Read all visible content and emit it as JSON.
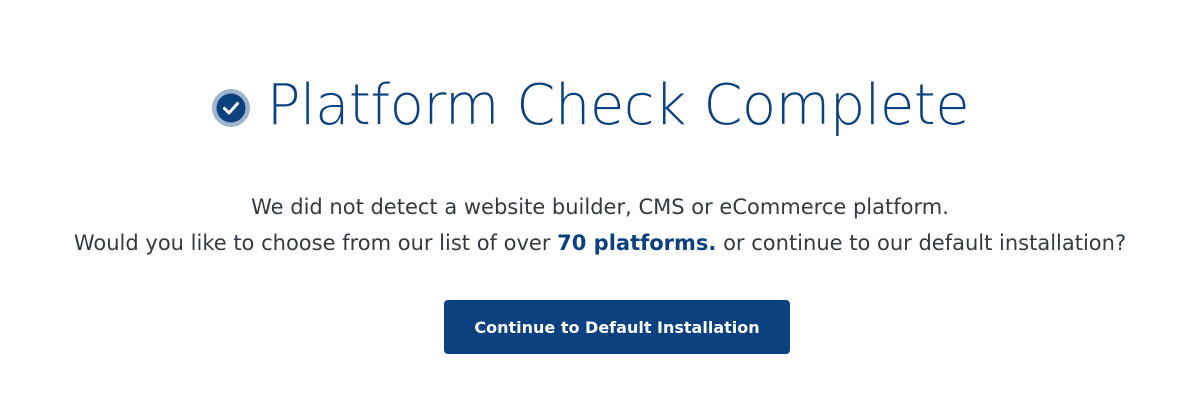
{
  "header": {
    "title": "Platform Check Complete",
    "badge_icon": "check-circle-icon"
  },
  "message": {
    "line1": "We did not detect a website builder, CMS or eCommerce platform.",
    "line2_before": "Would you like to choose from our list of over ",
    "line2_link": "70 platforms.",
    "line2_after": " or continue to our default installation?"
  },
  "actions": {
    "continue_label": "Continue to Default Installation"
  },
  "colors": {
    "brand_blue": "#0c4180",
    "badge_ring": "#9fb4cf",
    "body_text": "#333a40"
  }
}
